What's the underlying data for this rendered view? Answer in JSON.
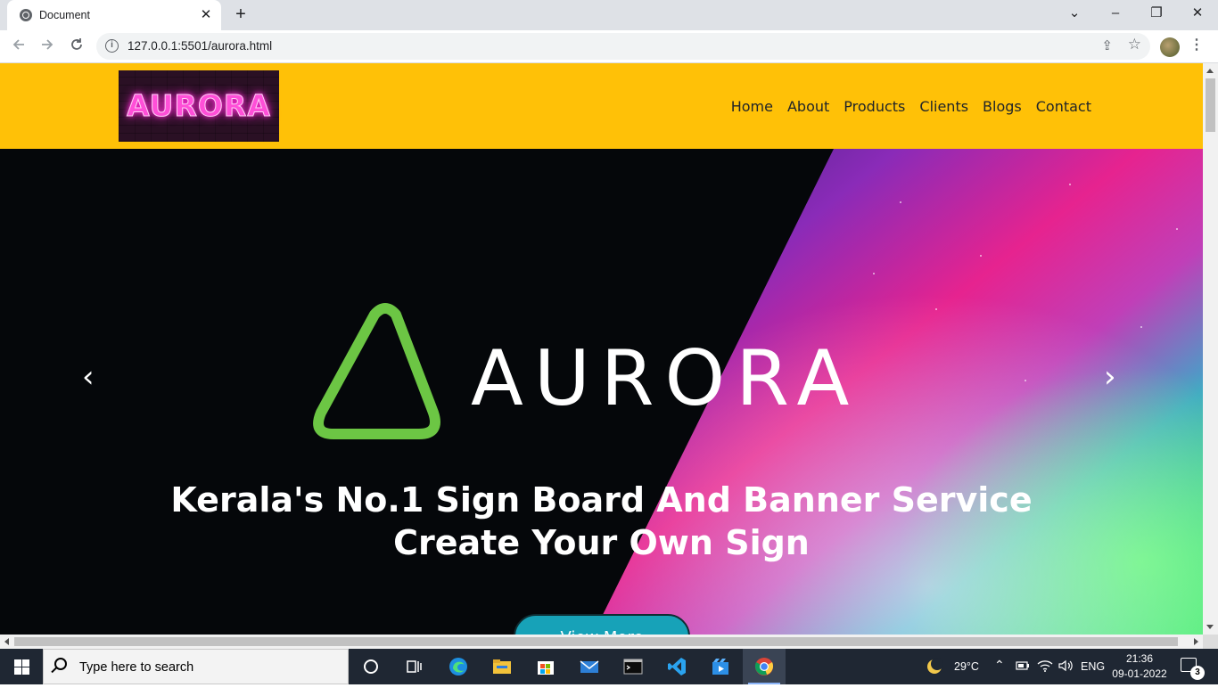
{
  "browser": {
    "tab_title": "Document",
    "tab_close": "✕",
    "new_tab": "+",
    "url": "127.0.0.1:5501/aurora.html",
    "controls": {
      "dropdown": "⌄",
      "minimize": "–",
      "restore": "❐",
      "close": "✕"
    }
  },
  "site": {
    "logo_text": "AURORA",
    "nav": [
      "Home",
      "About",
      "Products",
      "Clients",
      "Blogs",
      "Contact"
    ],
    "hero": {
      "brand": "AURORA",
      "caption_line1": "Kerala's No.1 Sign Board And Banner Service",
      "caption_line2": "Create Your Own Sign",
      "cta": "View More",
      "prev": "‹",
      "next": "›"
    },
    "colors": {
      "navbar": "#ffc107",
      "cta": "#17a2b8",
      "triangle": "#6cc644"
    }
  },
  "taskbar": {
    "search_placeholder": "Type here to search",
    "weather": "29°C",
    "language": "ENG",
    "time": "21:36",
    "date": "09-01-2022",
    "notifications": "3",
    "apps": [
      "cortana-icon",
      "task-view-icon",
      "edge-icon",
      "file-explorer-icon",
      "store-icon",
      "mail-icon",
      "terminal-icon",
      "vscode-icon",
      "media-icon",
      "chrome-icon"
    ]
  }
}
